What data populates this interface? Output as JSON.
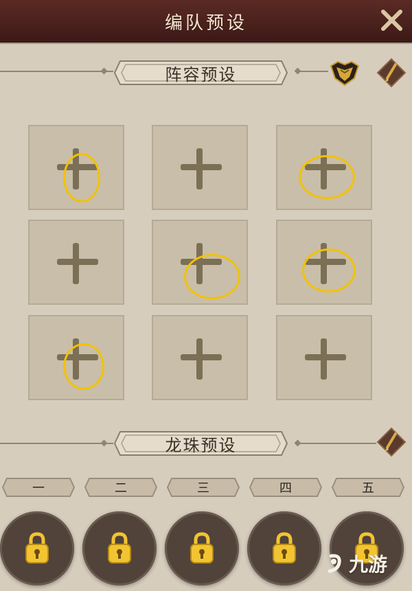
{
  "header": {
    "title": "编队预设"
  },
  "lineup_section": {
    "label": "阵容预设"
  },
  "dragon_section": {
    "label": "龙珠预设"
  },
  "tabs": [
    {
      "label": "一"
    },
    {
      "label": "二"
    },
    {
      "label": "三"
    },
    {
      "label": "四"
    },
    {
      "label": "五"
    }
  ],
  "slots": [
    {
      "state": "empty",
      "icon": "plus-icon"
    },
    {
      "state": "empty",
      "icon": "plus-icon"
    },
    {
      "state": "empty",
      "icon": "plus-icon"
    },
    {
      "state": "empty",
      "icon": "plus-icon"
    },
    {
      "state": "empty",
      "icon": "plus-icon"
    },
    {
      "state": "empty",
      "icon": "plus-icon"
    },
    {
      "state": "empty",
      "icon": "plus-icon"
    },
    {
      "state": "empty",
      "icon": "plus-icon"
    },
    {
      "state": "empty",
      "icon": "plus-icon"
    }
  ],
  "dragon_slots": [
    {
      "state": "locked",
      "icon": "lock-icon"
    },
    {
      "state": "locked",
      "icon": "lock-icon"
    },
    {
      "state": "locked",
      "icon": "lock-icon"
    },
    {
      "state": "locked",
      "icon": "lock-icon"
    },
    {
      "state": "locked",
      "icon": "lock-icon"
    }
  ],
  "watermark": {
    "text": "九游"
  },
  "colors": {
    "header_bg": "#4a211d",
    "page_bg": "#d6cdbd",
    "highlight_circle": "#f2c200",
    "lock_gold": "#f2c431"
  }
}
